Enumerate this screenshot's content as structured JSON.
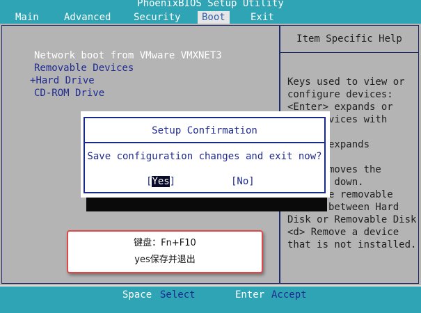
{
  "header": {
    "title": "PhoenixBIOS Setup Utility"
  },
  "menu": [
    {
      "label": "Main",
      "active": false
    },
    {
      "label": "Advanced",
      "active": false
    },
    {
      "label": "Security",
      "active": false
    },
    {
      "label": "Boot",
      "active": true
    },
    {
      "label": "Exit",
      "active": false
    }
  ],
  "boot_list": [
    {
      "label": "Network boot from VMware VMXNET3",
      "selected": true
    },
    {
      "label": "Removable Devices",
      "selected": false
    },
    {
      "prefix": "+",
      "label": "Hard Drive",
      "selected": false
    },
    {
      "label": "CD-ROM Drive",
      "selected": false
    }
  ],
  "help": {
    "header": "Item Specific Help",
    "text": "Keys used to view or\nconfigure devices:\n<Enter> expands or\n   s devices with\n\n   er> expands\n\n   <-> moves the\n     or down.\n     ove removable\ndevice between Hard\nDisk or Removable Disk\n<d> Remove a device\nthat is not installed."
  },
  "dialog": {
    "title": "Setup Confirmation",
    "message": "Save configuration changes and exit now?",
    "yes_label": "Yes",
    "no_label": "[No]"
  },
  "annotation": {
    "line1": "键盘：Fn+F10",
    "line2": "yes保存并退出"
  },
  "status": [
    {
      "key": "Space",
      "action": "Select"
    },
    {
      "key": "Enter",
      "action": "Accept"
    }
  ]
}
